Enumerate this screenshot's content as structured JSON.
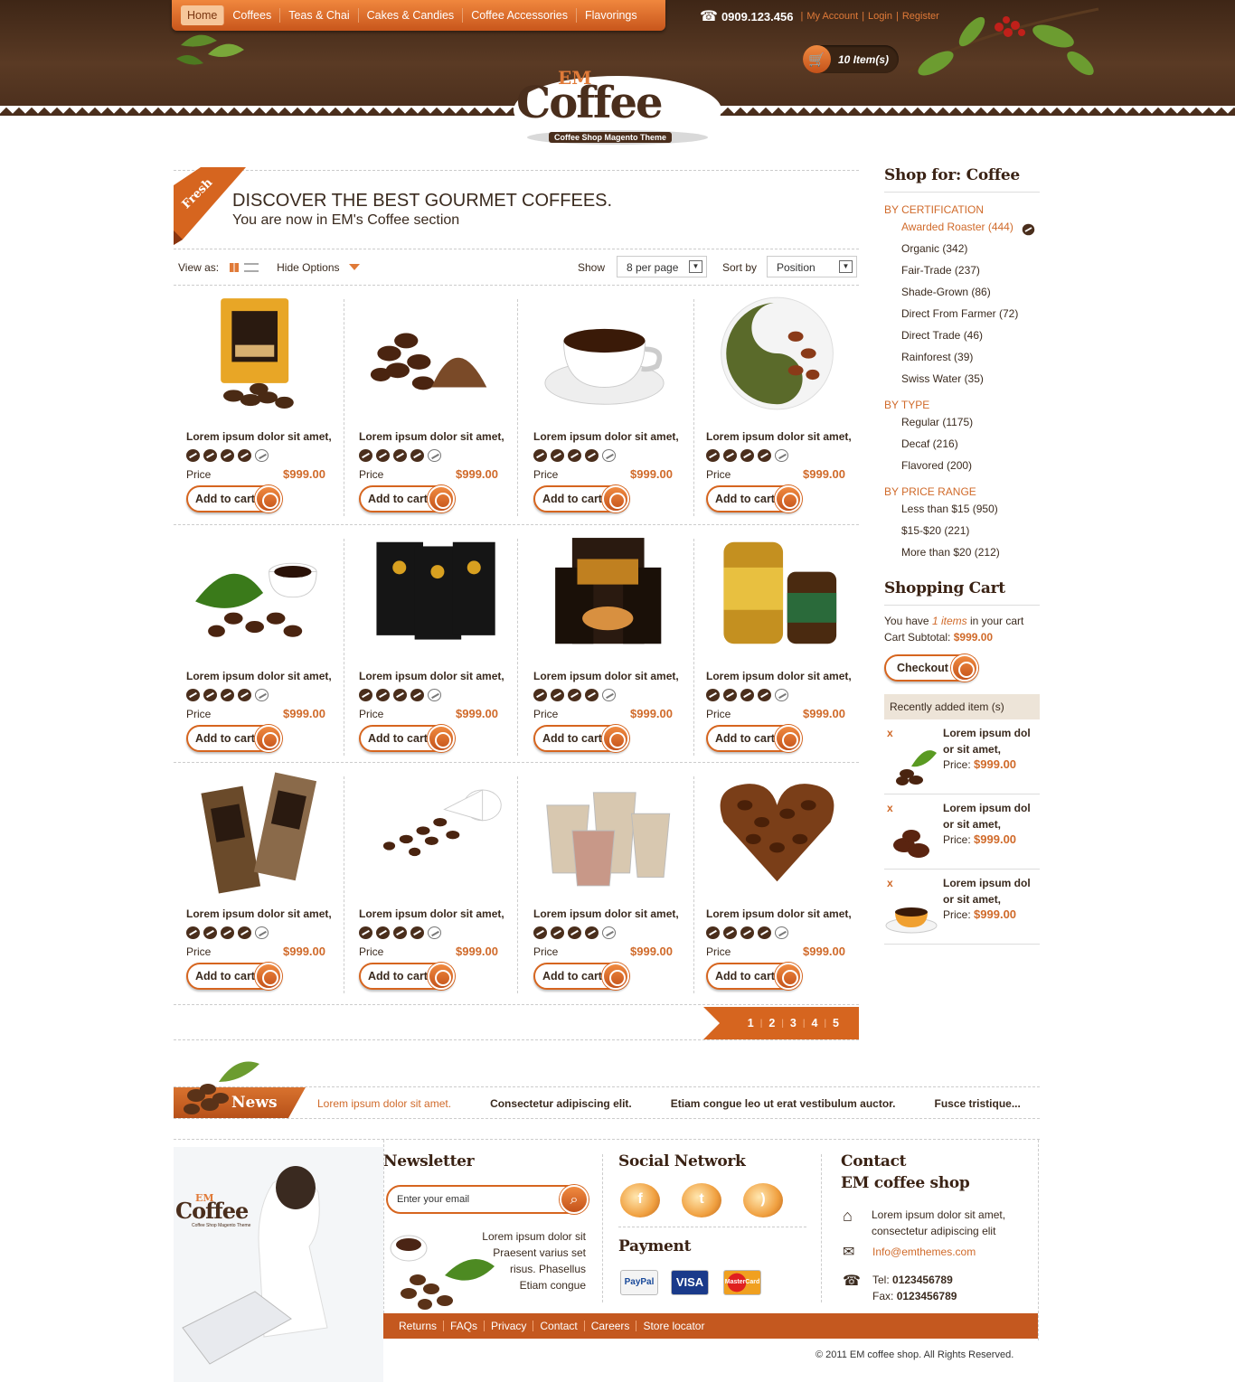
{
  "nav": {
    "items": [
      "Home",
      "Coffees",
      "Teas & Chai",
      "Cakes & Candies",
      "Coffee Accessories",
      "Flavorings"
    ]
  },
  "top": {
    "phone": "0909.123.456",
    "links": [
      "My Account",
      "Login",
      "Register"
    ],
    "cart": "10 Item(s)"
  },
  "logo": {
    "em": "EM",
    "name": "Coffee",
    "tagline": "Coffee Shop Magento Theme"
  },
  "banner": {
    "ribbon": "Fresh",
    "title": "DISCOVER THE BEST GOURMET COFFEES.",
    "subtitle": "You are now in EM's Coffee section"
  },
  "toolbar": {
    "view_label": "View as:",
    "hide_options": "Hide Options",
    "show_label": "Show",
    "show_value": "8 per page",
    "sort_label": "Sort by",
    "sort_value": "Position"
  },
  "products": [
    {
      "name": "Lorem ipsum dolor sit amet,",
      "price": "$999.00",
      "rating": 4,
      "image": "coffee-bag"
    },
    {
      "name": "Lorem ipsum dolor sit amet,",
      "price": "$999.00",
      "rating": 4,
      "image": "beans-ground"
    },
    {
      "name": "Lorem ipsum dolor sit amet,",
      "price": "$999.00",
      "rating": 4,
      "image": "cup"
    },
    {
      "name": "Lorem ipsum dolor sit amet,",
      "price": "$999.00",
      "rating": 4,
      "image": "tea-beans-plate"
    },
    {
      "name": "Lorem ipsum dolor sit amet,",
      "price": "$999.00",
      "rating": 4,
      "image": "cup-leaf"
    },
    {
      "name": "Lorem ipsum dolor sit amet,",
      "price": "$999.00",
      "rating": 4,
      "image": "black-bags"
    },
    {
      "name": "Lorem ipsum dolor sit amet,",
      "price": "$999.00",
      "rating": 4,
      "image": "boxes"
    },
    {
      "name": "Lorem ipsum dolor sit amet,",
      "price": "$999.00",
      "rating": 4,
      "image": "jars"
    },
    {
      "name": "Lorem ipsum dolor sit amet,",
      "price": "$999.00",
      "rating": 4,
      "image": "bars"
    },
    {
      "name": "Lorem ipsum dolor sit amet,",
      "price": "$999.00",
      "rating": 4,
      "image": "spilled-cup"
    },
    {
      "name": "Lorem ipsum dolor sit amet,",
      "price": "$999.00",
      "rating": 4,
      "image": "paper-cups"
    },
    {
      "name": "Lorem ipsum dolor sit amet,",
      "price": "$999.00",
      "rating": 4,
      "image": "heart-beans"
    }
  ],
  "product_labels": {
    "price": "Price",
    "add_to_cart": "Add to cart"
  },
  "pager": [
    "1",
    "2",
    "3",
    "4",
    "5"
  ],
  "sidebar": {
    "title": "Shop for: Coffee",
    "groups": [
      {
        "title": "BY CERTIFICATION",
        "items": [
          "Awarded Roaster (444)",
          "Organic (342)",
          "Fair-Trade (237)",
          "Shade-Grown (86)",
          "Direct From Farmer (72)",
          "Direct Trade (46)",
          "Rainforest (39)",
          "Swiss Water (35)"
        ]
      },
      {
        "title": "BY TYPE",
        "items": [
          "Regular (1175)",
          "Decaf (216)",
          "Flavored (200)"
        ]
      },
      {
        "title": "BY PRICE RANGE",
        "items": [
          "Less than $15 (950)",
          "$15-$20 (221)",
          "More than $20 (212)"
        ]
      }
    ]
  },
  "cart": {
    "title": "Shopping Cart",
    "you_have": "You have",
    "items": "1 items",
    "in_cart": "in your cart",
    "subtotal_label": "Cart Subtotal:",
    "subtotal": "$999.00",
    "checkout": "Checkout",
    "recent_title": "Recently added item (s)",
    "recent": [
      {
        "name": "Lorem ipsum dol or sit amet,",
        "price_label": "Price:",
        "price": "$999.00",
        "x": "x"
      },
      {
        "name": "Lorem ipsum dol or sit amet,",
        "price_label": "Price:",
        "price": "$999.00",
        "x": "x"
      },
      {
        "name": "Lorem ipsum dol or sit amet,",
        "price_label": "Price:",
        "price": "$999.00",
        "x": "x"
      }
    ]
  },
  "news": {
    "title": "News",
    "items": [
      "Lorem ipsum dolor sit amet.",
      "Consectetur adipiscing elit.",
      "Etiam congue leo ut erat vestibulum auctor.",
      "Fusce tristique..."
    ]
  },
  "newsletter": {
    "title": "Newsletter",
    "placeholder": "Enter your email",
    "text": [
      "Lorem ipsum dolor sit",
      "Praesent varius set",
      "risus. Phasellus",
      "Etiam congue"
    ]
  },
  "social": {
    "title": "Social Network",
    "icons": [
      "facebook-icon",
      "twitter-icon",
      "rss-icon"
    ],
    "glyphs": [
      "f",
      "t",
      ")"
    ]
  },
  "payment": {
    "title": "Payment",
    "methods": [
      "PayPal",
      "VISA",
      "MasterCard"
    ]
  },
  "contact": {
    "title1": "Contact",
    "title2": "EM coffee shop",
    "address1": "Lorem ipsum dolor sit amet,",
    "address2": "consectetur adipiscing elit",
    "email": "Info@emthemes.com",
    "tel_label": "Tel:",
    "tel": "0123456789",
    "fax_label": "Fax:",
    "fax": "0123456789"
  },
  "footer_links": [
    "Returns",
    "FAQs",
    "Privacy",
    "Contact",
    "Careers",
    "Store locator"
  ],
  "copyright": "© 2011 EM coffee shop. All Rights Reserved.",
  "colors": {
    "accent": "#d6651f",
    "brown": "#4a2e1c"
  }
}
